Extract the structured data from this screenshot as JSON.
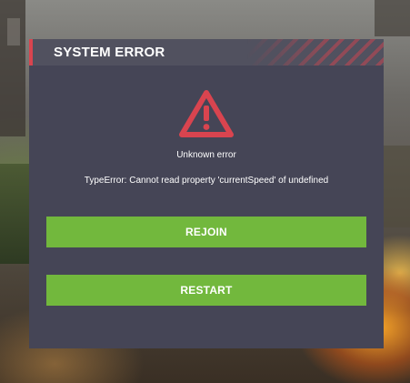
{
  "dialog": {
    "title": "SYSTEM ERROR",
    "icon": "warning-icon",
    "message": "Unknown error",
    "detail": "TypeError: Cannot read property 'currentSpeed' of undefined",
    "buttons": {
      "rejoin": "REJOIN",
      "restart": "RESTART"
    }
  },
  "colors": {
    "panel": "#454556",
    "header": "#51515f",
    "accent": "#d9444f",
    "button": "#72b83d"
  }
}
